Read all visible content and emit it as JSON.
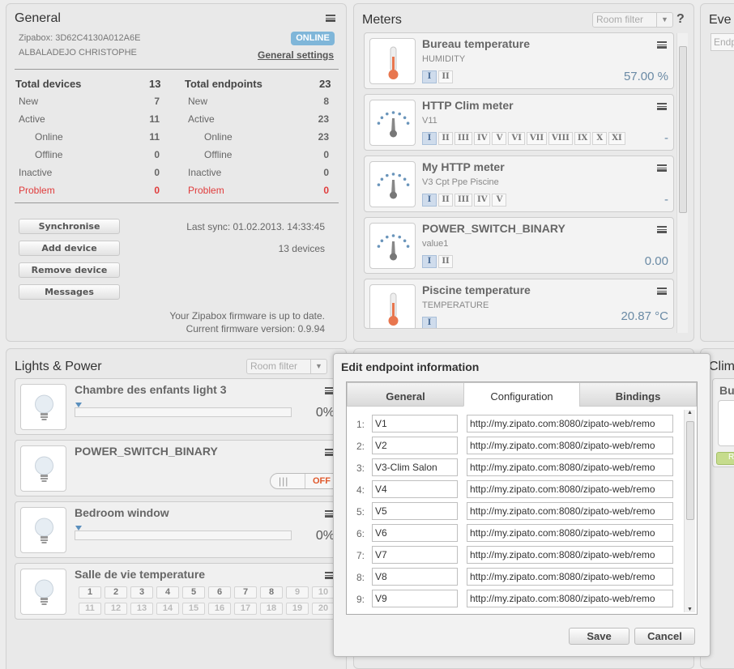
{
  "general": {
    "title": "General",
    "zipabox": "Zipabox: 3D62C4130A012A6E",
    "owner": "ALBALADEJO CHRISTOPHE",
    "status_badge": "ONLINE",
    "settings_link": "General settings",
    "devices": {
      "header": "Total devices",
      "total": "13",
      "rows": [
        {
          "label": "New",
          "value": "7"
        },
        {
          "label": "Active",
          "value": "11"
        },
        {
          "label": "Online",
          "value": "11"
        },
        {
          "label": "Offline",
          "value": "0"
        },
        {
          "label": "Inactive",
          "value": "0"
        },
        {
          "label": "Problem",
          "value": "0"
        }
      ]
    },
    "endpoints": {
      "header": "Total endpoints",
      "total": "23",
      "rows": [
        {
          "label": "New",
          "value": "8"
        },
        {
          "label": "Active",
          "value": "23"
        },
        {
          "label": "Online",
          "value": "23"
        },
        {
          "label": "Offline",
          "value": "0"
        },
        {
          "label": "Inactive",
          "value": "0"
        },
        {
          "label": "Problem",
          "value": "0"
        }
      ]
    },
    "buttons": {
      "sync": "Synchronise",
      "add": "Add device",
      "remove": "Remove device",
      "messages": "Messages"
    },
    "last_sync": "Last sync: 01.02.2013. 14:33:45",
    "device_count": "13 devices",
    "firmware_line1": "Your Zipabox firmware is up to date.",
    "firmware_line2": "Current firmware version: 0.9.94"
  },
  "meters": {
    "title": "Meters",
    "room_filter": "Room filter",
    "help": "?",
    "items": [
      {
        "name": "Bureau temperature",
        "sub": "HUMIDITY",
        "tabs": [
          "I",
          "II"
        ],
        "value": "57.00 %",
        "icon": "thermometer-icon"
      },
      {
        "name": "HTTP Clim meter",
        "sub": "V11",
        "tabs": [
          "I",
          "II",
          "III",
          "IV",
          "V",
          "VI",
          "VII",
          "VIII",
          "IX",
          "X",
          "XI"
        ],
        "value": "-",
        "icon": "gauge-icon"
      },
      {
        "name": "My HTTP meter",
        "sub": "V3 Cpt Ppe Piscine",
        "tabs": [
          "I",
          "II",
          "III",
          "IV",
          "V"
        ],
        "value": "-",
        "icon": "gauge-icon"
      },
      {
        "name": "POWER_SWITCH_BINARY",
        "sub": "value1",
        "tabs": [
          "I",
          "II"
        ],
        "value": "0.00",
        "icon": "gauge-icon"
      },
      {
        "name": "Piscine temperature",
        "sub": "TEMPERATURE",
        "tabs": [
          "I"
        ],
        "value": "20.87 °C",
        "icon": "thermometer-icon"
      }
    ]
  },
  "events": {
    "title": "Eve",
    "input_placeholder": "Endp"
  },
  "lights": {
    "title": "Lights & Power",
    "room_filter": "Room filter",
    "items": [
      {
        "name": "Chambre des enfants light 3",
        "pct": "0%",
        "level": 0
      },
      {
        "name": "POWER_SWITCH_BINARY",
        "toggle_off": "OFF",
        "toggle_grip": "|||"
      },
      {
        "name": "Bedroom window",
        "pct": "0%",
        "level": 0
      },
      {
        "name": "Salle de vie temperature",
        "row1": [
          "1",
          "2",
          "3",
          "4",
          "5",
          "6",
          "7",
          "8",
          "9",
          "10"
        ],
        "row2": [
          "11",
          "12",
          "13",
          "14",
          "15",
          "16",
          "17",
          "18",
          "19",
          "20"
        ]
      }
    ]
  },
  "climate": {
    "title": "Clim",
    "item": "Bur",
    "btn": "R"
  },
  "dialog": {
    "title": "Edit endpoint information",
    "tabs": [
      "General",
      "Configuration",
      "Bindings"
    ],
    "rows": [
      {
        "n": "1:",
        "name": "V1",
        "url": "http://my.zipato.com:8080/zipato-web/remo"
      },
      {
        "n": "2:",
        "name": "V2",
        "url": "http://my.zipato.com:8080/zipato-web/remo"
      },
      {
        "n": "3:",
        "name": "V3-Clim Salon",
        "url": "http://my.zipato.com:8080/zipato-web/remo"
      },
      {
        "n": "4:",
        "name": "V4",
        "url": "http://my.zipato.com:8080/zipato-web/remo"
      },
      {
        "n": "5:",
        "name": "V5",
        "url": "http://my.zipato.com:8080/zipato-web/remo"
      },
      {
        "n": "6:",
        "name": "V6",
        "url": "http://my.zipato.com:8080/zipato-web/remo"
      },
      {
        "n": "7:",
        "name": "V7",
        "url": "http://my.zipato.com:8080/zipato-web/remo"
      },
      {
        "n": "8:",
        "name": "V8",
        "url": "http://my.zipato.com:8080/zipato-web/remo"
      },
      {
        "n": "9:",
        "name": "V9",
        "url": "http://my.zipato.com:8080/zipato-web/remo"
      }
    ],
    "save": "Save",
    "cancel": "Cancel"
  },
  "colors": {
    "accent": "#6a8aa5",
    "problem": "#e03c3c",
    "badge": "#7fb6d9"
  }
}
